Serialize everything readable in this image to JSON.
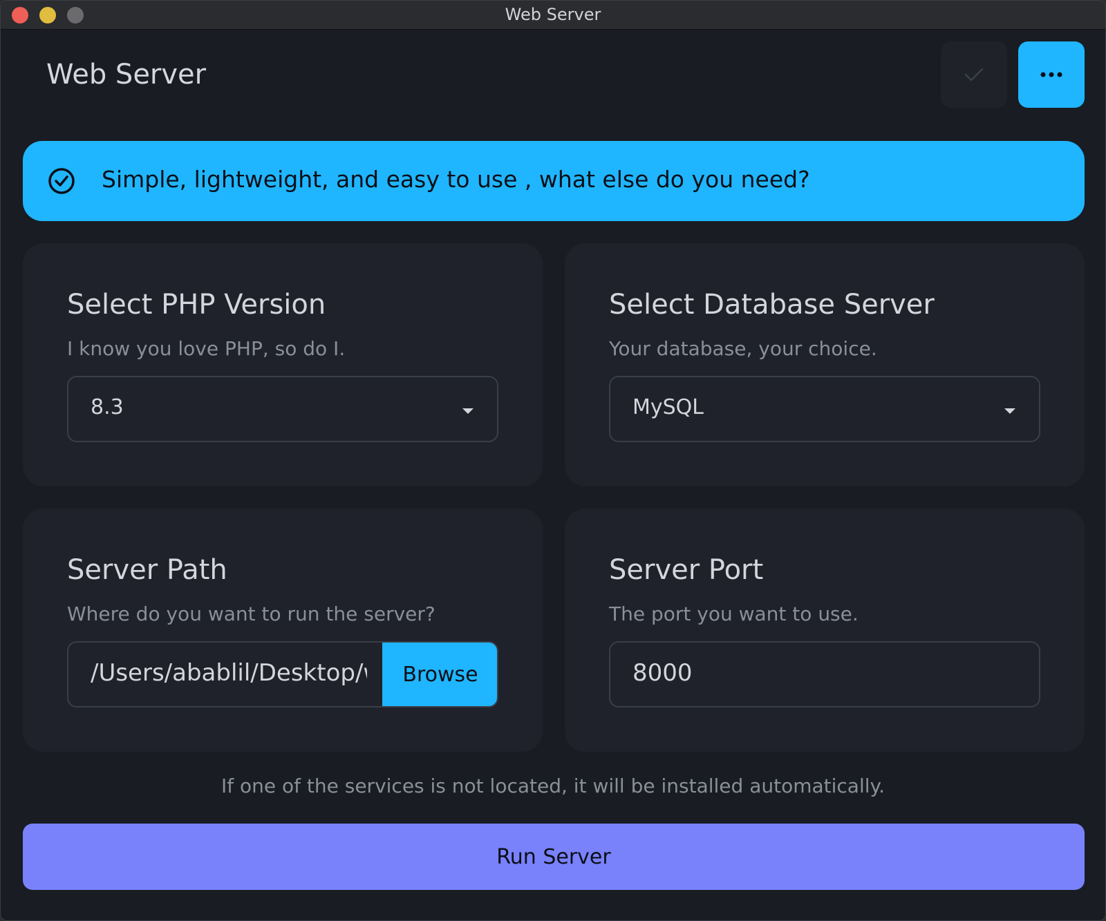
{
  "window": {
    "title": "Web Server"
  },
  "header": {
    "title": "Web Server",
    "check_icon": "check-icon",
    "more_icon": "ellipsis-icon"
  },
  "banner": {
    "icon": "check-circle-icon",
    "text": "Simple, lightweight, and easy to use , what else do you need?"
  },
  "php": {
    "title": "Select PHP Version",
    "subtitle": "I know you love PHP, so do I.",
    "selected": "8.3"
  },
  "database": {
    "title": "Select Database Server",
    "subtitle": "Your database, your choice.",
    "selected": "MySQL"
  },
  "path": {
    "title": "Server Path",
    "subtitle": "Where do you want to run the server?",
    "value": "/Users/abablil/Desktop/www",
    "browse_label": "Browse"
  },
  "port": {
    "title": "Server Port",
    "subtitle": "The port you want to use.",
    "value": "8000"
  },
  "footnote": "If one of the services is not located, it will be installed automatically.",
  "run_label": "Run Server",
  "colors": {
    "accent": "#1fb6ff",
    "run_button": "#7982fb",
    "background": "#191c22",
    "card": "#1f222a"
  }
}
